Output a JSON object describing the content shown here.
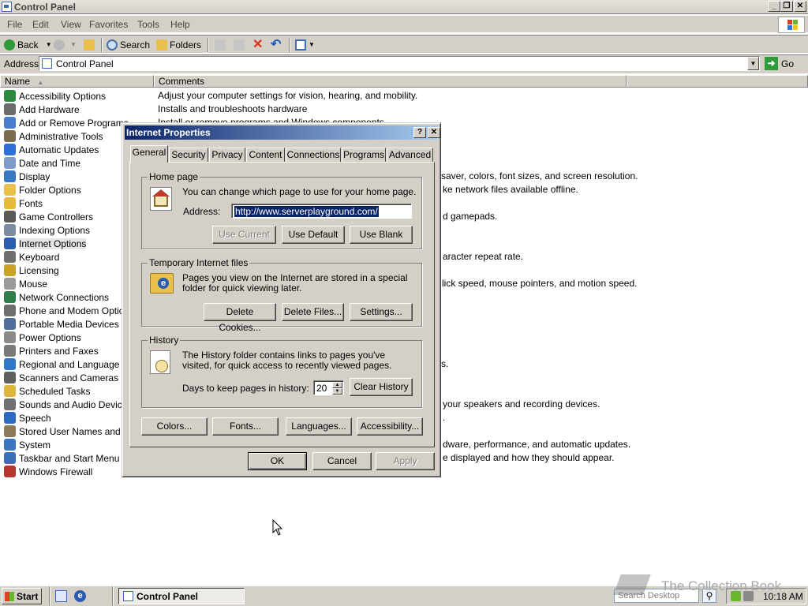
{
  "window": {
    "title": "Control Panel"
  },
  "menu": [
    "File",
    "Edit",
    "View",
    "Favorites",
    "Tools",
    "Help"
  ],
  "toolbar": {
    "back": "Back",
    "search": "Search",
    "folders": "Folders"
  },
  "address": {
    "label": "Address",
    "value": "Control Panel",
    "go": "Go"
  },
  "columns": {
    "name": "Name",
    "comments": "Comments"
  },
  "items": [
    {
      "label": "Accessibility Options",
      "icon": "accessibility-icon",
      "color": "#2b8a3e"
    },
    {
      "label": "Add Hardware",
      "icon": "add-hardware-icon",
      "color": "#6b6b6b"
    },
    {
      "label": "Add or Remove Programs",
      "icon": "add-remove-programs-icon",
      "color": "#4a7cc9"
    },
    {
      "label": "Administrative Tools",
      "icon": "admin-tools-icon",
      "color": "#7a6a4f"
    },
    {
      "label": "Automatic Updates",
      "icon": "automatic-updates-icon",
      "color": "#2d6fd6"
    },
    {
      "label": "Date and Time",
      "icon": "date-time-icon",
      "color": "#7e9bc9"
    },
    {
      "label": "Display",
      "icon": "display-icon",
      "color": "#3b78c4"
    },
    {
      "label": "Folder Options",
      "icon": "folder-options-icon",
      "color": "#e8c04a"
    },
    {
      "label": "Fonts",
      "icon": "fonts-icon",
      "color": "#e6b93c"
    },
    {
      "label": "Game Controllers",
      "icon": "game-controllers-icon",
      "color": "#5a5a5a"
    },
    {
      "label": "Indexing Options",
      "icon": "indexing-options-icon",
      "color": "#7d8ba3"
    },
    {
      "label": "Internet Options",
      "icon": "internet-options-icon",
      "color": "#2a5db0"
    },
    {
      "label": "Keyboard",
      "icon": "keyboard-icon",
      "color": "#6f6f6f"
    },
    {
      "label": "Licensing",
      "icon": "licensing-icon",
      "color": "#c9a227"
    },
    {
      "label": "Mouse",
      "icon": "mouse-icon",
      "color": "#9a9a9a"
    },
    {
      "label": "Network Connections",
      "icon": "network-connections-icon",
      "color": "#2f7d4a"
    },
    {
      "label": "Phone and Modem Options",
      "icon": "phone-modem-icon",
      "color": "#6d6d6d"
    },
    {
      "label": "Portable Media Devices",
      "icon": "portable-media-icon",
      "color": "#4e6e9e"
    },
    {
      "label": "Power Options",
      "icon": "power-options-icon",
      "color": "#8a8a8a"
    },
    {
      "label": "Printers and Faxes",
      "icon": "printers-faxes-icon",
      "color": "#7a7a7a"
    },
    {
      "label": "Regional and Language Opt",
      "icon": "regional-language-icon",
      "color": "#2f78c8"
    },
    {
      "label": "Scanners and Cameras",
      "icon": "scanners-cameras-icon",
      "color": "#5f5f5f"
    },
    {
      "label": "Scheduled Tasks",
      "icon": "scheduled-tasks-icon",
      "color": "#e0b53c"
    },
    {
      "label": "Sounds and Audio Devices",
      "icon": "sounds-audio-icon",
      "color": "#707070"
    },
    {
      "label": "Speech",
      "icon": "speech-icon",
      "color": "#2c6bc2"
    },
    {
      "label": "Stored User Names and Pas",
      "icon": "stored-user-names-icon",
      "color": "#8c7a58"
    },
    {
      "label": "System",
      "icon": "system-icon",
      "color": "#3a75c0"
    },
    {
      "label": "Taskbar and Start Menu",
      "icon": "taskbar-start-icon",
      "color": "#3a6fb8"
    },
    {
      "label": "Windows Firewall",
      "icon": "windows-firewall-icon",
      "color": "#b3372f"
    }
  ],
  "comments": [
    "Adjust your computer settings for vision, hearing, and mobility.",
    "Installs and troubleshoots hardware",
    "Install or remove programs and Windows components.",
    "saver, colors, font sizes, and screen resolution.",
    "ke network files available offline.",
    "d gamepads.",
    "aracter repeat rate.",
    "lick speed, mouse pointers, and motion speed.",
    "s.",
    "your speakers and recording devices.",
    ".",
    "dware, performance, and automatic updates.",
    "e displayed and how they should appear."
  ],
  "dialog": {
    "title": "Internet Properties",
    "tabs": [
      "General",
      "Security",
      "Privacy",
      "Content",
      "Connections",
      "Programs",
      "Advanced"
    ],
    "home": {
      "group": "Home page",
      "desc": "You can change which page to use for your home page.",
      "address_label": "Address:",
      "address_value": "http://www.serverplayground.com/",
      "use_current": "Use Current",
      "use_default": "Use Default",
      "use_blank": "Use Blank"
    },
    "temp": {
      "group": "Temporary Internet files",
      "desc": "Pages you view on the Internet are stored in a special folder for quick viewing later.",
      "delete_cookies": "Delete Cookies...",
      "delete_files": "Delete Files...",
      "settings": "Settings..."
    },
    "history": {
      "group": "History",
      "desc": "The History folder contains links to pages you've visited, for quick access to recently viewed pages.",
      "days_label": "Days to keep pages in history:",
      "days_value": "20",
      "clear": "Clear History"
    },
    "bottom": {
      "colors": "Colors...",
      "fonts": "Fonts...",
      "languages": "Languages...",
      "accessibility": "Accessibility..."
    },
    "ok": "OK",
    "cancel": "Cancel",
    "apply": "Apply"
  },
  "taskbar": {
    "start": "Start",
    "task": "Control Panel",
    "search_placeholder": "Search Desktop",
    "clock": "10:18 AM"
  },
  "watermark": "The Collection Book"
}
